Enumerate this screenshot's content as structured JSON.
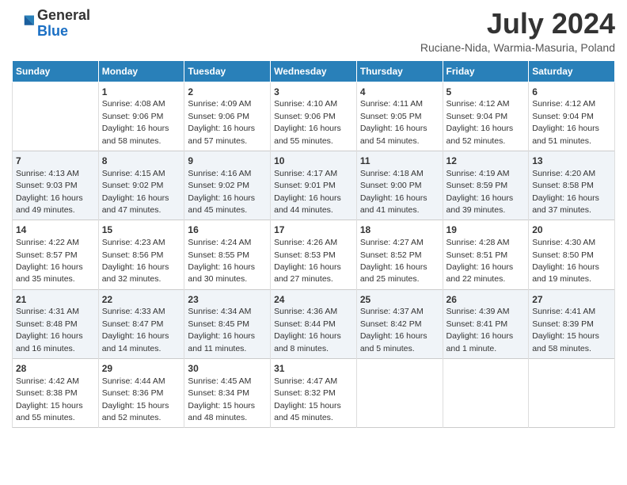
{
  "header": {
    "logo_general": "General",
    "logo_blue": "Blue",
    "month_title": "July 2024",
    "location": "Ruciane-Nida, Warmia-Masuria, Poland"
  },
  "days_of_week": [
    "Sunday",
    "Monday",
    "Tuesday",
    "Wednesday",
    "Thursday",
    "Friday",
    "Saturday"
  ],
  "weeks": [
    [
      {
        "day": "",
        "sunrise": "",
        "sunset": "",
        "daylight": ""
      },
      {
        "day": "1",
        "sunrise": "Sunrise: 4:08 AM",
        "sunset": "Sunset: 9:06 PM",
        "daylight": "Daylight: 16 hours and 58 minutes."
      },
      {
        "day": "2",
        "sunrise": "Sunrise: 4:09 AM",
        "sunset": "Sunset: 9:06 PM",
        "daylight": "Daylight: 16 hours and 57 minutes."
      },
      {
        "day": "3",
        "sunrise": "Sunrise: 4:10 AM",
        "sunset": "Sunset: 9:06 PM",
        "daylight": "Daylight: 16 hours and 55 minutes."
      },
      {
        "day": "4",
        "sunrise": "Sunrise: 4:11 AM",
        "sunset": "Sunset: 9:05 PM",
        "daylight": "Daylight: 16 hours and 54 minutes."
      },
      {
        "day": "5",
        "sunrise": "Sunrise: 4:12 AM",
        "sunset": "Sunset: 9:04 PM",
        "daylight": "Daylight: 16 hours and 52 minutes."
      },
      {
        "day": "6",
        "sunrise": "Sunrise: 4:12 AM",
        "sunset": "Sunset: 9:04 PM",
        "daylight": "Daylight: 16 hours and 51 minutes."
      }
    ],
    [
      {
        "day": "7",
        "sunrise": "Sunrise: 4:13 AM",
        "sunset": "Sunset: 9:03 PM",
        "daylight": "Daylight: 16 hours and 49 minutes."
      },
      {
        "day": "8",
        "sunrise": "Sunrise: 4:15 AM",
        "sunset": "Sunset: 9:02 PM",
        "daylight": "Daylight: 16 hours and 47 minutes."
      },
      {
        "day": "9",
        "sunrise": "Sunrise: 4:16 AM",
        "sunset": "Sunset: 9:02 PM",
        "daylight": "Daylight: 16 hours and 45 minutes."
      },
      {
        "day": "10",
        "sunrise": "Sunrise: 4:17 AM",
        "sunset": "Sunset: 9:01 PM",
        "daylight": "Daylight: 16 hours and 44 minutes."
      },
      {
        "day": "11",
        "sunrise": "Sunrise: 4:18 AM",
        "sunset": "Sunset: 9:00 PM",
        "daylight": "Daylight: 16 hours and 41 minutes."
      },
      {
        "day": "12",
        "sunrise": "Sunrise: 4:19 AM",
        "sunset": "Sunset: 8:59 PM",
        "daylight": "Daylight: 16 hours and 39 minutes."
      },
      {
        "day": "13",
        "sunrise": "Sunrise: 4:20 AM",
        "sunset": "Sunset: 8:58 PM",
        "daylight": "Daylight: 16 hours and 37 minutes."
      }
    ],
    [
      {
        "day": "14",
        "sunrise": "Sunrise: 4:22 AM",
        "sunset": "Sunset: 8:57 PM",
        "daylight": "Daylight: 16 hours and 35 minutes."
      },
      {
        "day": "15",
        "sunrise": "Sunrise: 4:23 AM",
        "sunset": "Sunset: 8:56 PM",
        "daylight": "Daylight: 16 hours and 32 minutes."
      },
      {
        "day": "16",
        "sunrise": "Sunrise: 4:24 AM",
        "sunset": "Sunset: 8:55 PM",
        "daylight": "Daylight: 16 hours and 30 minutes."
      },
      {
        "day": "17",
        "sunrise": "Sunrise: 4:26 AM",
        "sunset": "Sunset: 8:53 PM",
        "daylight": "Daylight: 16 hours and 27 minutes."
      },
      {
        "day": "18",
        "sunrise": "Sunrise: 4:27 AM",
        "sunset": "Sunset: 8:52 PM",
        "daylight": "Daylight: 16 hours and 25 minutes."
      },
      {
        "day": "19",
        "sunrise": "Sunrise: 4:28 AM",
        "sunset": "Sunset: 8:51 PM",
        "daylight": "Daylight: 16 hours and 22 minutes."
      },
      {
        "day": "20",
        "sunrise": "Sunrise: 4:30 AM",
        "sunset": "Sunset: 8:50 PM",
        "daylight": "Daylight: 16 hours and 19 minutes."
      }
    ],
    [
      {
        "day": "21",
        "sunrise": "Sunrise: 4:31 AM",
        "sunset": "Sunset: 8:48 PM",
        "daylight": "Daylight: 16 hours and 16 minutes."
      },
      {
        "day": "22",
        "sunrise": "Sunrise: 4:33 AM",
        "sunset": "Sunset: 8:47 PM",
        "daylight": "Daylight: 16 hours and 14 minutes."
      },
      {
        "day": "23",
        "sunrise": "Sunrise: 4:34 AM",
        "sunset": "Sunset: 8:45 PM",
        "daylight": "Daylight: 16 hours and 11 minutes."
      },
      {
        "day": "24",
        "sunrise": "Sunrise: 4:36 AM",
        "sunset": "Sunset: 8:44 PM",
        "daylight": "Daylight: 16 hours and 8 minutes."
      },
      {
        "day": "25",
        "sunrise": "Sunrise: 4:37 AM",
        "sunset": "Sunset: 8:42 PM",
        "daylight": "Daylight: 16 hours and 5 minutes."
      },
      {
        "day": "26",
        "sunrise": "Sunrise: 4:39 AM",
        "sunset": "Sunset: 8:41 PM",
        "daylight": "Daylight: 16 hours and 1 minute."
      },
      {
        "day": "27",
        "sunrise": "Sunrise: 4:41 AM",
        "sunset": "Sunset: 8:39 PM",
        "daylight": "Daylight: 15 hours and 58 minutes."
      }
    ],
    [
      {
        "day": "28",
        "sunrise": "Sunrise: 4:42 AM",
        "sunset": "Sunset: 8:38 PM",
        "daylight": "Daylight: 15 hours and 55 minutes."
      },
      {
        "day": "29",
        "sunrise": "Sunrise: 4:44 AM",
        "sunset": "Sunset: 8:36 PM",
        "daylight": "Daylight: 15 hours and 52 minutes."
      },
      {
        "day": "30",
        "sunrise": "Sunrise: 4:45 AM",
        "sunset": "Sunset: 8:34 PM",
        "daylight": "Daylight: 15 hours and 48 minutes."
      },
      {
        "day": "31",
        "sunrise": "Sunrise: 4:47 AM",
        "sunset": "Sunset: 8:32 PM",
        "daylight": "Daylight: 15 hours and 45 minutes."
      },
      {
        "day": "",
        "sunrise": "",
        "sunset": "",
        "daylight": ""
      },
      {
        "day": "",
        "sunrise": "",
        "sunset": "",
        "daylight": ""
      },
      {
        "day": "",
        "sunrise": "",
        "sunset": "",
        "daylight": ""
      }
    ]
  ]
}
